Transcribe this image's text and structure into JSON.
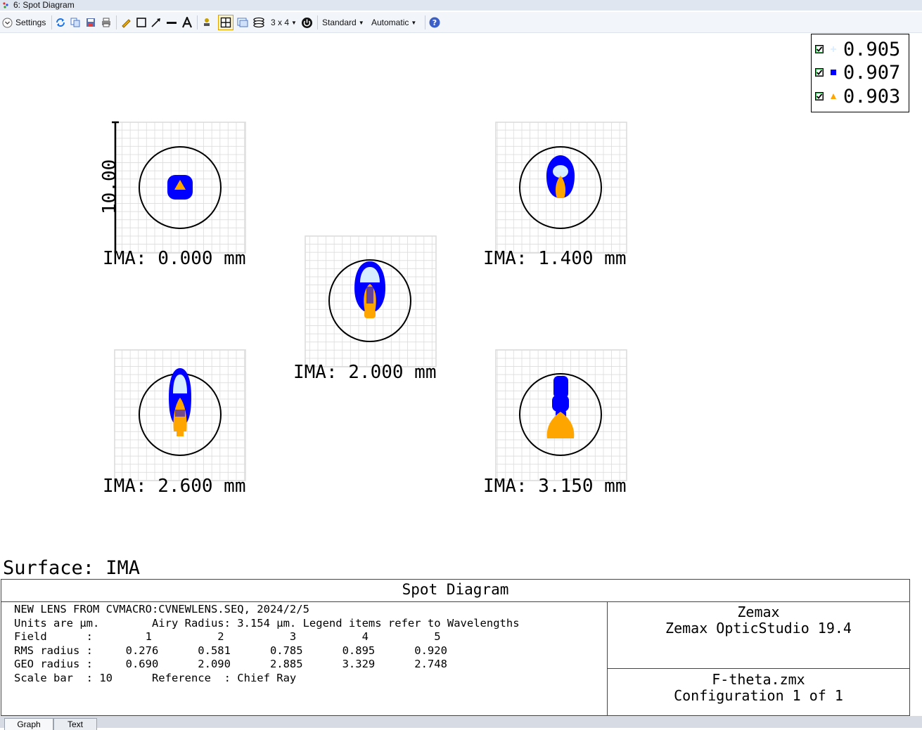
{
  "window": {
    "title": "6: Spot Diagram"
  },
  "toolbar": {
    "settings_label": "Settings",
    "layout_label": "3 x 4",
    "standard_label": "Standard",
    "automatic_label": "Automatic"
  },
  "legend": [
    {
      "value": "0.905",
      "color": "#d6ecff",
      "symbol": "plus-icon"
    },
    {
      "value": "0.907",
      "color": "#0000ff",
      "symbol": "square-icon"
    },
    {
      "value": "0.903",
      "color": "#ffa500",
      "symbol": "triangle-icon"
    }
  ],
  "plot": {
    "scale_bar_label": "10.00",
    "fields": [
      {
        "label": "IMA: 0.000 mm"
      },
      {
        "label": "IMA: 1.400 mm"
      },
      {
        "label": "IMA: 2.000 mm"
      },
      {
        "label": "IMA: 2.600 mm"
      },
      {
        "label": "IMA: 3.150 mm"
      }
    ]
  },
  "surface_label": "Surface: IMA",
  "info": {
    "title": "Spot Diagram",
    "lines": [
      "NEW LENS FROM CVMACRO:CVNEWLENS.SEQ, 2024/2/5",
      "Units are µm.        Airy Radius: 3.154 µm. Legend items refer to Wavelengths",
      "Field      :        1          2          3          4          5",
      "RMS radius :     0.276      0.581      0.785      0.895      0.920",
      "GEO radius :     0.690      2.090      2.885      3.329      2.748",
      "Scale bar  : 10      Reference  : Chief Ray"
    ],
    "company": "Zemax",
    "product": "Zemax OpticStudio 19.4",
    "file": "F-theta.zmx",
    "config": "Configuration 1 of 1"
  },
  "tabs": [
    "Graph",
    "Text"
  ]
}
